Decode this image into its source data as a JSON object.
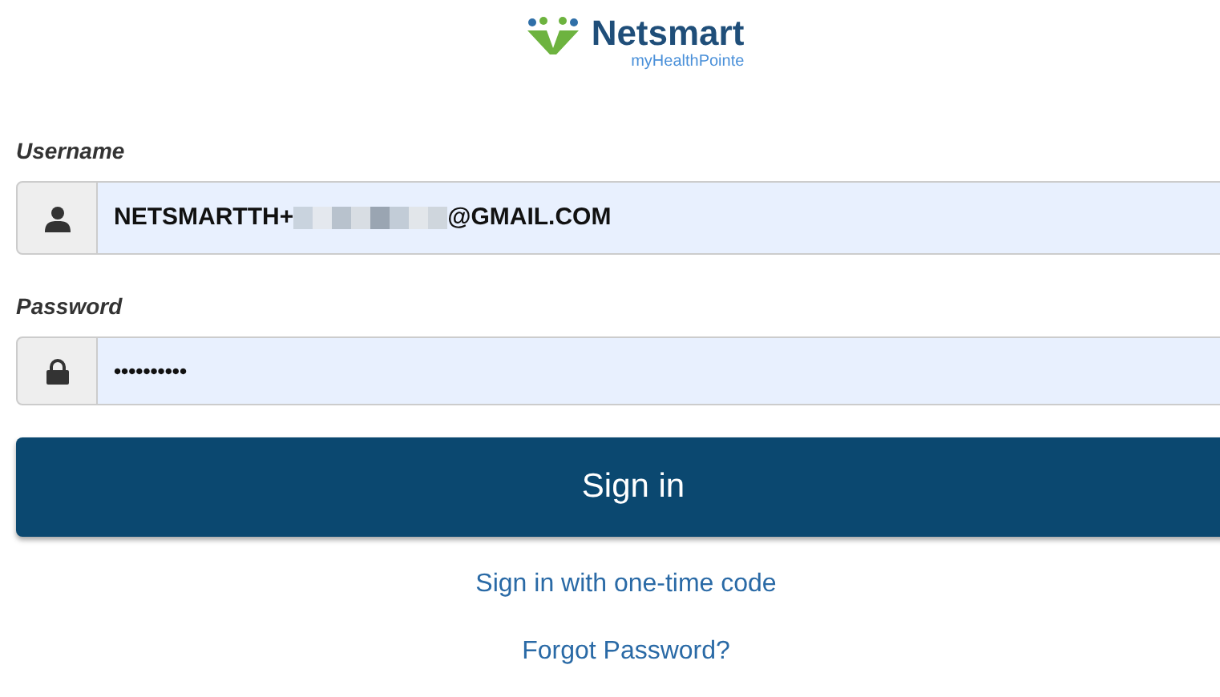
{
  "logo": {
    "brand": "Netsmart",
    "product": "myHealthPointe"
  },
  "username": {
    "label": "Username",
    "value_before_redaction": "NETSMARTTH+",
    "value_after_redaction": "@GMAIL.COM",
    "redacted": true
  },
  "password": {
    "label": "Password",
    "value": "••••••••••"
  },
  "sign_in_button": "Sign in",
  "links": [
    "Sign in with one-time code",
    "Forgot Password?"
  ]
}
